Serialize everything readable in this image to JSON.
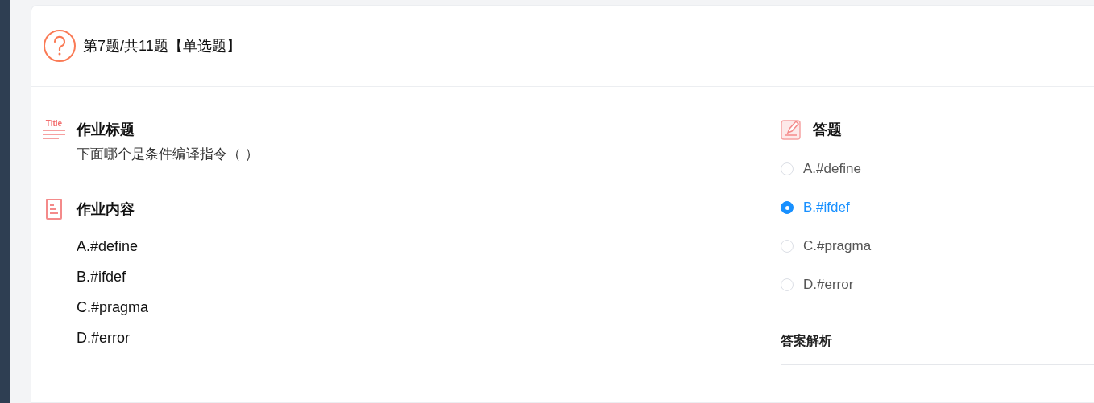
{
  "header": {
    "title": "第7题/共11题【单选题】"
  },
  "assignment": {
    "title_section": {
      "icon_text": "Title",
      "heading": "作业标题",
      "text": "下面哪个是条件编译指令（ ）"
    },
    "content_section": {
      "heading": "作业内容",
      "lines": [
        "A.#define",
        "B.#ifdef",
        "C.#pragma",
        "D.#error"
      ]
    }
  },
  "answer": {
    "heading": "答题",
    "options": [
      {
        "label": "A.#define",
        "selected": false
      },
      {
        "label": "B.#ifdef",
        "selected": true
      },
      {
        "label": "C.#pragma",
        "selected": false
      },
      {
        "label": "D.#error",
        "selected": false
      }
    ],
    "analysis_label": "答案解析"
  }
}
